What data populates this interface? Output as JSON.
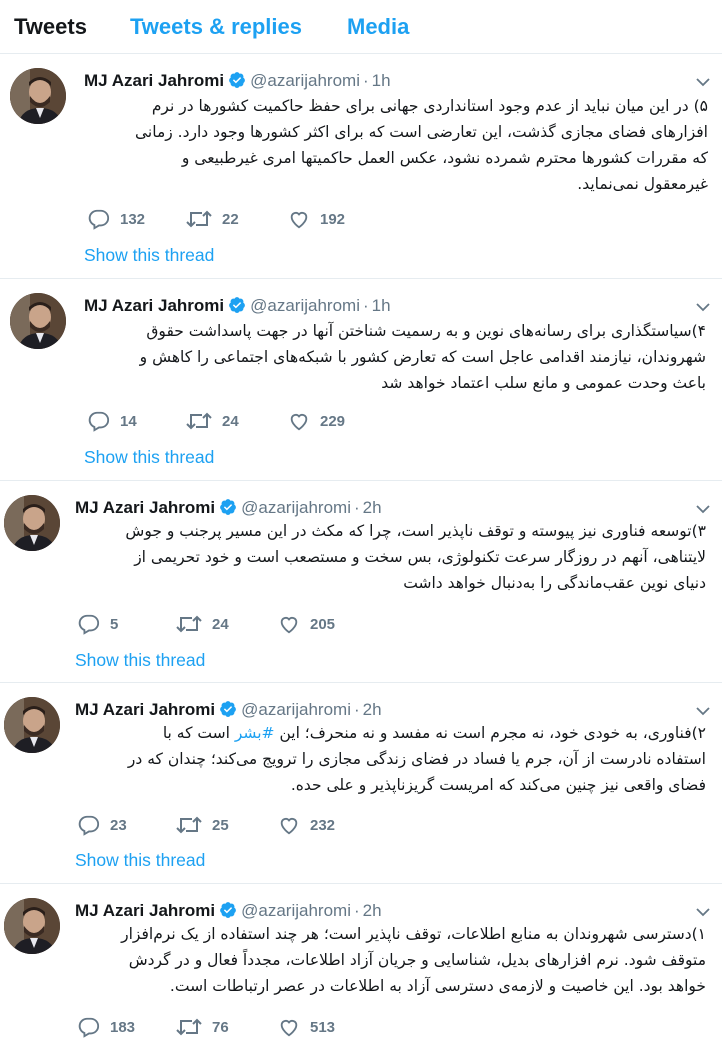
{
  "tabs": [
    "Tweets",
    "Tweets & replies",
    "Media"
  ],
  "tweets": [
    {
      "name": "MJ Azari Jahromi",
      "handle": "@azarijahromi",
      "dot": "·",
      "time": "1h",
      "lines": [
        "۵) در این میان نباید از عدم وجود استانداردی جهانی برای حفظ حاکمیت کشورها در نرم",
        "افزارهای فضای مجازی گذشت، این تعارضی است که برای اکثر کشورها وجود دارد. زمانی",
        "که  مقررات کشورها محترم شمرده نشود، عکس العمل حاکمیتها امری غیرطبیعی و",
        "غیرمعقول نمی‌نماید."
      ],
      "replies": "132",
      "retweets": "22",
      "likes": "192",
      "thread": "Show this thread"
    },
    {
      "name": "MJ Azari Jahromi",
      "handle": "@azarijahromi",
      "dot": "·",
      "time": "1h",
      "lines": [
        "۴)سیاستگذاری برای رسانه‌های نوین و به رسمیت شناختن آنها در جهت پاسداشت حقوق",
        "شهروندان، نیازمند اقدامی عاجل است که تعارض کشور با شبکه‌های اجتماعی را کاهش و",
        "باعث وحدت عمومی و مانع سلب اعتماد خواهد شد"
      ],
      "replies": "14",
      "retweets": "24",
      "likes": "229",
      "thread": "Show this thread"
    },
    {
      "name": "MJ Azari Jahromi",
      "handle": "@azarijahromi",
      "dot": "·",
      "time": "2h",
      "lines": [
        "۳)توسعه فناوری نیز پیوسته و توقف ناپذیر است، چرا که مکث در این مسیر پرجنب و جوش",
        "لایتناهی، آنهم در روزگار سرعت تکنولوژی، بس سخت و مستصعب است و خود تحریمی از",
        "دنیای نوین عقب‌ماندگی را به‌دنبال خواهد داشت"
      ],
      "replies": "5",
      "retweets": "24",
      "likes": "205",
      "thread": "Show this thread"
    },
    {
      "name": "MJ Azari Jahromi",
      "handle": "@azarijahromi",
      "dot": "·",
      "time": "2h",
      "line1_before": "۲)فناوری، به خودی خود، نه مجرم است نه مفسد و نه منحرف؛ این ",
      "hashtag": "#بشر",
      "line1_after": " است که با",
      "lines": [
        "استفاده نادرست از آن، جرم یا فساد در فضای زندگی مجازی را ترویج می‌کند؛ چندان که در",
        "فضای واقعی نیز چنین می‌کند که امریست گریزناپذیر و علی حده."
      ],
      "replies": "23",
      "retweets": "25",
      "likes": "232",
      "thread": "Show this thread"
    },
    {
      "name": "MJ Azari Jahromi",
      "handle": "@azarijahromi",
      "dot": "·",
      "time": "2h",
      "lines": [
        "۱)دسترسی شهروندان به منابع اطلاعات، توقف ناپذیر است؛ هر چند استفاده از یک نرم‌افزار",
        "متوقف شود. نرم افزارهای بدیل، شناسایی و جریان آزاد اطلاعات، مجدداً فعال و در گردش",
        "خواهد بود. این خاصیت و لازمه‌ی دسترسی آزاد به اطلاعات در عصر ارتباطات است."
      ],
      "replies": "183",
      "retweets": "76",
      "likes": "513"
    }
  ],
  "icons": {
    "reply": "reply-icon",
    "retweet": "retweet-icon",
    "like": "heart-icon",
    "verified": "verified-badge-icon",
    "caret": "chevron-down-icon"
  },
  "colors": {
    "accent": "#1da1f2",
    "text": "#14171a",
    "muted": "#657786",
    "divider": "#e6ecf0"
  }
}
